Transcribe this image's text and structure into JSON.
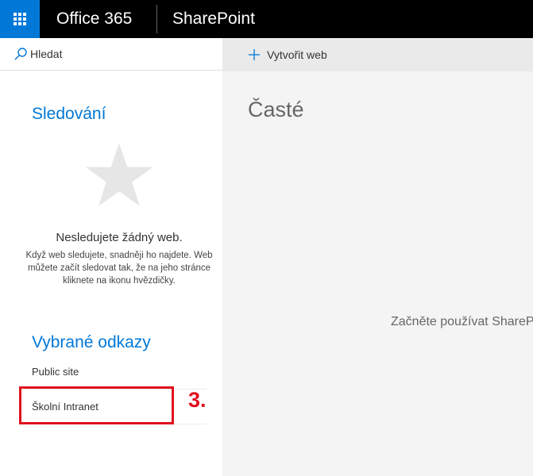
{
  "suite_bar": {
    "brand": "Office 365",
    "app_name": "SharePoint"
  },
  "search": {
    "placeholder": "Hledat"
  },
  "following": {
    "title": "Sledování",
    "empty_heading": "Nesledujete žádný web.",
    "empty_body": "Když web sledujete, snadněji ho najdete. Web můžete začít sledovat tak, že na jeho stránce kliknete na ikonu hvězdičky."
  },
  "featured_links": {
    "title": "Vybrané odkazy",
    "items": [
      {
        "label": "Public site"
      },
      {
        "label": "Školní Intranet"
      }
    ]
  },
  "annotation": {
    "step": "3.",
    "color": "#e0101e"
  },
  "command_bar": {
    "create_label": "Vytvořit web"
  },
  "main": {
    "frequent_title": "Časté",
    "start_text": "Začněte používat SharePoint"
  },
  "colors": {
    "accent": "#0078d7",
    "topbar": "#000000"
  }
}
